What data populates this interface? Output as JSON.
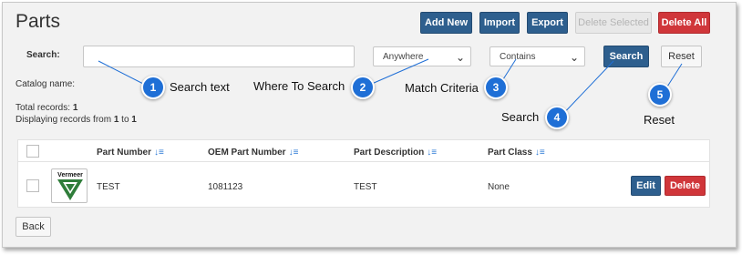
{
  "page": {
    "title": "Parts"
  },
  "toolbar": {
    "add_new": "Add New",
    "import": "Import",
    "export": "Export",
    "delete_selected": "Delete Selected",
    "delete_all": "Delete All"
  },
  "search": {
    "label": "Search:",
    "value": "",
    "where": "Anywhere",
    "match": "Contains",
    "search_button": "Search",
    "reset_button": "Reset"
  },
  "catalog": {
    "label": "Catalog name:"
  },
  "stats": {
    "total_label": "Total records:",
    "total_value": "1",
    "displaying_prefix": "Displaying records from",
    "from": "1",
    "to_word": "to",
    "to": "1"
  },
  "callouts": [
    {
      "number": "1",
      "text": "Search text"
    },
    {
      "number": "2",
      "text": "Where To Search"
    },
    {
      "number": "3",
      "text": "Match Criteria"
    },
    {
      "number": "4",
      "text": "Search"
    },
    {
      "number": "5",
      "text": "Reset"
    }
  ],
  "table": {
    "columns": [
      "Part Number",
      "OEM Part Number",
      "Part Description",
      "Part Class"
    ],
    "sort_glyph": "↓≡",
    "rows": [
      {
        "logo_text": "Vermeer",
        "part_number": "TEST",
        "oem_part_number": "1081123",
        "description": "TEST",
        "part_class": "None",
        "edit": "Edit",
        "delete": "Delete"
      }
    ]
  },
  "footer": {
    "back": "Back"
  },
  "colors": {
    "primary": "#2e5f8e",
    "danger": "#d0363a",
    "callout": "#1f6fd6",
    "sort_icon": "#2e7bd6",
    "logo_green": "#2f7d3a"
  },
  "icons": {
    "dropdown": "chevron-down-icon",
    "sort": "sort-icon"
  }
}
